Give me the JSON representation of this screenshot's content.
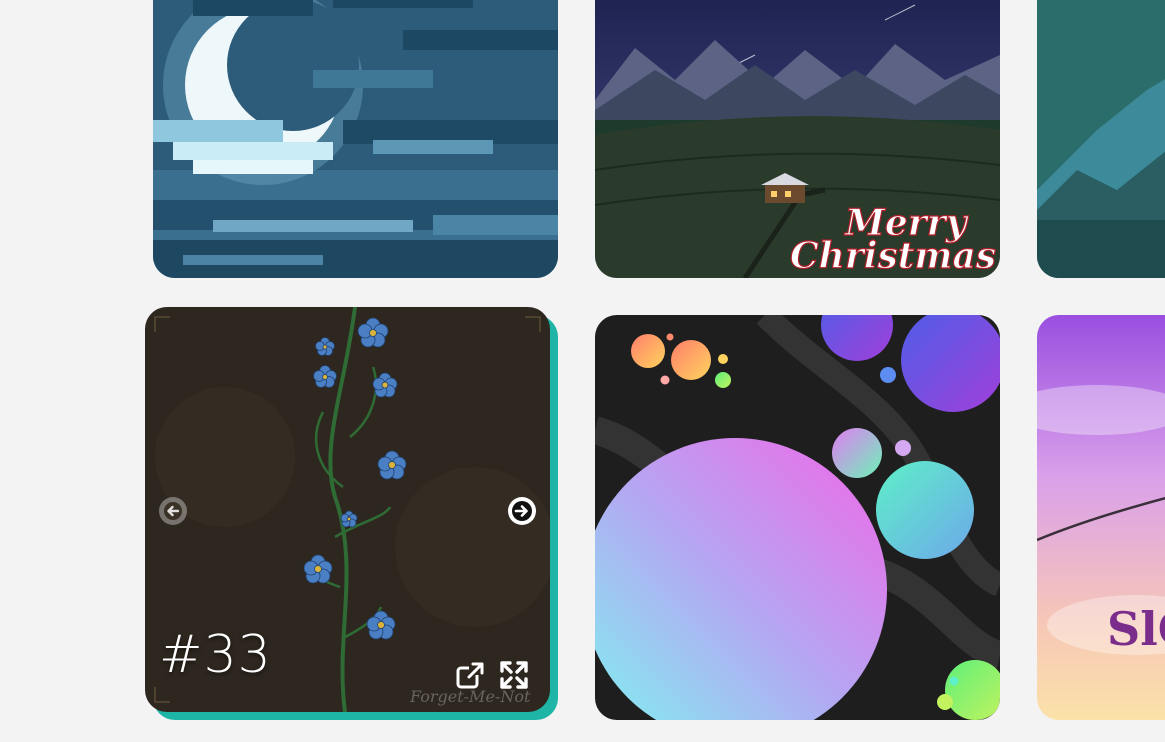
{
  "gallery": {
    "active_slide": {
      "number": "#33",
      "signature": "Forget-Me-Not",
      "accent_color": "#1fb5a6",
      "background_color": "#2e271f",
      "controls": {
        "prev_icon": "arrow-left-icon",
        "next_icon": "arrow-right-icon",
        "open_icon": "external-link-icon",
        "fullscreen_icon": "expand-icon"
      }
    },
    "cards": [
      {
        "subject": "pixel-moon-clouds"
      },
      {
        "subject": "christmas-night",
        "greeting_line1": "Merry",
        "greeting_line2": "Christmas"
      },
      {
        "subject": "pixel-mountain-forest"
      },
      {
        "subject": "gradient-circles"
      },
      {
        "subject": "pastel-sky",
        "partial_text": "SlO"
      }
    ]
  }
}
